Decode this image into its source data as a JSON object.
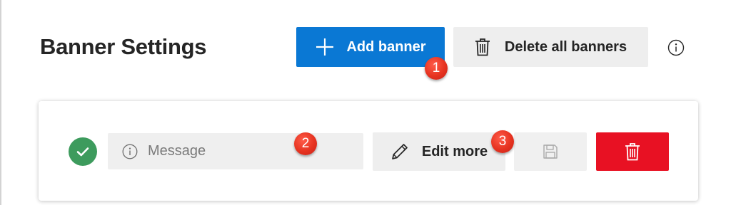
{
  "header": {
    "title": "Banner Settings",
    "add_banner_label": "Add banner",
    "delete_all_label": "Delete all banners"
  },
  "banner_row": {
    "message_placeholder": "Message",
    "message_value": "",
    "edit_more_label": "Edit more"
  },
  "annotations": {
    "badge_1": "1",
    "badge_2": "2",
    "badge_3": "3"
  },
  "colors": {
    "accent": "#0a78d4",
    "danger": "#e81123",
    "success": "#3d9b5d",
    "annotation": "#e63320"
  },
  "icons": {
    "add": "plus-icon",
    "delete_all": "trash-icon",
    "info": "info-icon",
    "status": "check-icon",
    "message": "info-icon",
    "edit": "pencil-icon",
    "save": "save-icon",
    "remove": "trash-icon"
  }
}
